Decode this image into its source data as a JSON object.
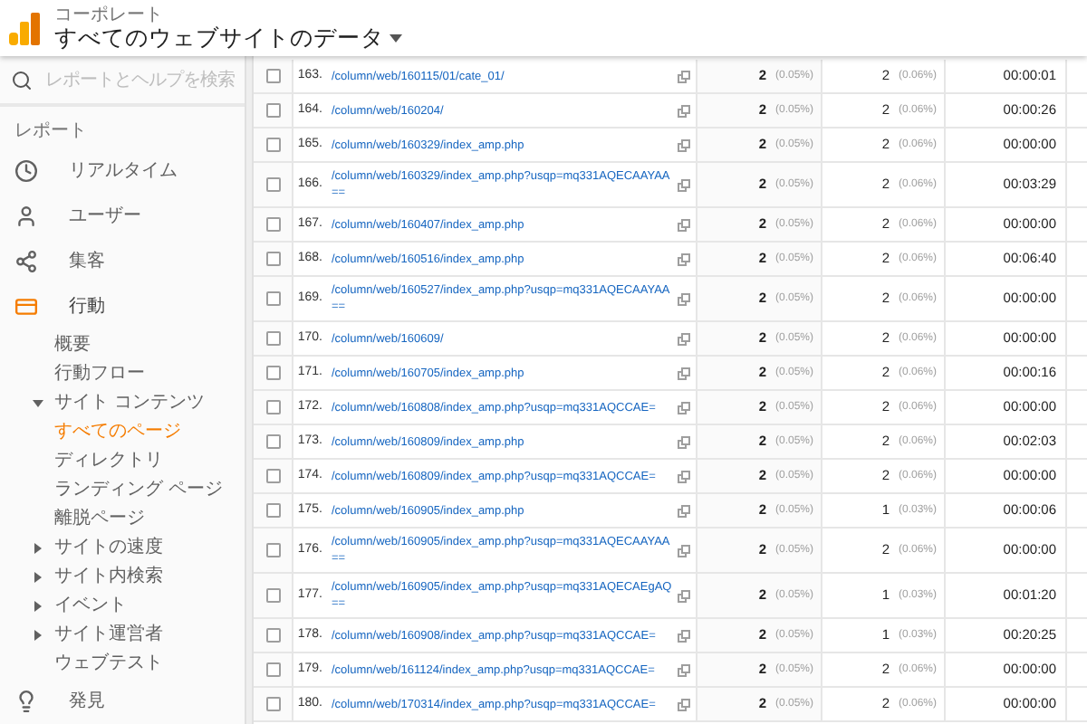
{
  "header": {
    "account": "コーポレート",
    "view_title": "すべてのウェブサイトのデータ"
  },
  "sidebar": {
    "search_placeholder": "レポートとヘルプを検索",
    "heading": "レポート",
    "items": [
      {
        "kind": "section",
        "label": "リアルタイム",
        "selected": false
      },
      {
        "kind": "section",
        "label": "ユーザー",
        "selected": false
      },
      {
        "kind": "section",
        "label": "集客",
        "selected": false
      },
      {
        "kind": "section",
        "label": "行動",
        "selected": true,
        "children": [
          {
            "label": "概要",
            "selected": false
          },
          {
            "label": "行動フロー",
            "selected": false
          },
          {
            "label": "サイト コンテンツ",
            "selected": false,
            "expanded": true,
            "children": [
              {
                "label": "すべてのページ",
                "selected": true
              },
              {
                "label": "ディレクトリ",
                "selected": false
              },
              {
                "label": "ランディング ページ",
                "selected": false
              },
              {
                "label": "離脱ページ",
                "selected": false
              }
            ]
          },
          {
            "label": "サイトの速度",
            "selected": false,
            "expanded": false
          },
          {
            "label": "サイト内検索",
            "selected": false,
            "expanded": false
          },
          {
            "label": "イベント",
            "selected": false,
            "expanded": false
          },
          {
            "label": "サイト運営者",
            "selected": false,
            "expanded": false
          },
          {
            "label": "ウェブテスト",
            "selected": false
          }
        ]
      },
      {
        "kind": "section",
        "label": "発見",
        "selected": false
      }
    ]
  },
  "table": {
    "rows": [
      {
        "checked": false,
        "number": "163.",
        "page": "/column/web/160115/01/cate_01/",
        "metric_1": "2",
        "metric_1_share": "(0.05%)",
        "metric_2": "2",
        "metric_2_share": "(0.06%)",
        "metric_3": "00:00:01"
      },
      {
        "checked": false,
        "number": "164.",
        "page": "/column/web/160204/",
        "metric_1": "2",
        "metric_1_share": "(0.05%)",
        "metric_2": "2",
        "metric_2_share": "(0.06%)",
        "metric_3": "00:00:26"
      },
      {
        "checked": false,
        "number": "165.",
        "page": "/column/web/160329/index_amp.php",
        "metric_1": "2",
        "metric_1_share": "(0.05%)",
        "metric_2": "2",
        "metric_2_share": "(0.06%)",
        "metric_3": "00:00:00"
      },
      {
        "checked": false,
        "number": "166.",
        "page": "/column/web/160329/index_amp.php?usqp=mq331AQECAAYAA==",
        "metric_1": "2",
        "metric_1_share": "(0.05%)",
        "metric_2": "2",
        "metric_2_share": "(0.06%)",
        "metric_3": "00:03:29"
      },
      {
        "checked": false,
        "number": "167.",
        "page": "/column/web/160407/index_amp.php",
        "metric_1": "2",
        "metric_1_share": "(0.05%)",
        "metric_2": "2",
        "metric_2_share": "(0.06%)",
        "metric_3": "00:00:00"
      },
      {
        "checked": false,
        "number": "168.",
        "page": "/column/web/160516/index_amp.php",
        "metric_1": "2",
        "metric_1_share": "(0.05%)",
        "metric_2": "2",
        "metric_2_share": "(0.06%)",
        "metric_3": "00:06:40"
      },
      {
        "checked": false,
        "number": "169.",
        "page": "/column/web/160527/index_amp.php?usqp=mq331AQECAAYAA==",
        "metric_1": "2",
        "metric_1_share": "(0.05%)",
        "metric_2": "2",
        "metric_2_share": "(0.06%)",
        "metric_3": "00:00:00"
      },
      {
        "checked": false,
        "number": "170.",
        "page": "/column/web/160609/",
        "metric_1": "2",
        "metric_1_share": "(0.05%)",
        "metric_2": "2",
        "metric_2_share": "(0.06%)",
        "metric_3": "00:00:00"
      },
      {
        "checked": false,
        "number": "171.",
        "page": "/column/web/160705/index_amp.php",
        "metric_1": "2",
        "metric_1_share": "(0.05%)",
        "metric_2": "2",
        "metric_2_share": "(0.06%)",
        "metric_3": "00:00:16"
      },
      {
        "checked": false,
        "number": "172.",
        "page": "/column/web/160808/index_amp.php?usqp=mq331AQCCAE=",
        "metric_1": "2",
        "metric_1_share": "(0.05%)",
        "metric_2": "2",
        "metric_2_share": "(0.06%)",
        "metric_3": "00:00:00"
      },
      {
        "checked": false,
        "number": "173.",
        "page": "/column/web/160809/index_amp.php",
        "metric_1": "2",
        "metric_1_share": "(0.05%)",
        "metric_2": "2",
        "metric_2_share": "(0.06%)",
        "metric_3": "00:02:03"
      },
      {
        "checked": false,
        "number": "174.",
        "page": "/column/web/160809/index_amp.php?usqp=mq331AQCCAE=",
        "metric_1": "2",
        "metric_1_share": "(0.05%)",
        "metric_2": "2",
        "metric_2_share": "(0.06%)",
        "metric_3": "00:00:00"
      },
      {
        "checked": false,
        "number": "175.",
        "page": "/column/web/160905/index_amp.php",
        "metric_1": "2",
        "metric_1_share": "(0.05%)",
        "metric_2": "1",
        "metric_2_share": "(0.03%)",
        "metric_3": "00:00:06"
      },
      {
        "checked": false,
        "number": "176.",
        "page": "/column/web/160905/index_amp.php?usqp=mq331AQECAAYAA==",
        "metric_1": "2",
        "metric_1_share": "(0.05%)",
        "metric_2": "2",
        "metric_2_share": "(0.06%)",
        "metric_3": "00:00:00"
      },
      {
        "checked": false,
        "number": "177.",
        "page": "/column/web/160905/index_amp.php?usqp=mq331AQECAEgAQ==",
        "metric_1": "2",
        "metric_1_share": "(0.05%)",
        "metric_2": "1",
        "metric_2_share": "(0.03%)",
        "metric_3": "00:01:20"
      },
      {
        "checked": false,
        "number": "178.",
        "page": "/column/web/160908/index_amp.php?usqp=mq331AQCCAE=",
        "metric_1": "2",
        "metric_1_share": "(0.05%)",
        "metric_2": "1",
        "metric_2_share": "(0.03%)",
        "metric_3": "00:20:25"
      },
      {
        "checked": false,
        "number": "179.",
        "page": "/column/web/161124/index_amp.php?usqp=mq331AQCCAE=",
        "metric_1": "2",
        "metric_1_share": "(0.05%)",
        "metric_2": "2",
        "metric_2_share": "(0.06%)",
        "metric_3": "00:00:00"
      },
      {
        "checked": false,
        "number": "180.",
        "page": "/column/web/170314/index_amp.php?usqp=mq331AQCCAE=",
        "metric_1": "2",
        "metric_1_share": "(0.05%)",
        "metric_2": "2",
        "metric_2_share": "(0.06%)",
        "metric_3": "00:00:00"
      }
    ]
  }
}
